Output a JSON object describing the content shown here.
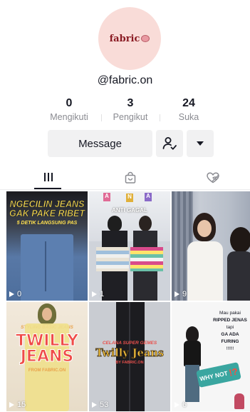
{
  "profile": {
    "avatar_text": "fabric",
    "username": "@fabric.on"
  },
  "stats": [
    {
      "value": "0",
      "label": "Mengikuti"
    },
    {
      "value": "3",
      "label": "Pengikut"
    },
    {
      "value": "24",
      "label": "Suka"
    }
  ],
  "actions": {
    "message_label": "Message",
    "follow_icon": "person-check-icon",
    "more_icon": "caret-down-icon"
  },
  "tabs": [
    {
      "name": "videos",
      "icon": "grid-icon",
      "active": true
    },
    {
      "name": "shop",
      "icon": "shopping-bag-icon",
      "active": false
    },
    {
      "name": "liked",
      "icon": "hidden-heart-icon",
      "active": false
    }
  ],
  "videos": [
    {
      "views": "0",
      "title_1": "NGECILIN JEANS",
      "title_2": "GAK PAKE RIBET",
      "subtitle": "5 DETIK LANGSUNG PAS"
    },
    {
      "views": "1",
      "title_1": "ANTI GAGAL",
      "letters": [
        "A",
        "N",
        "A"
      ]
    },
    {
      "views": "9"
    },
    {
      "views": "15",
      "title_1": "STYLING BASIC JEANS",
      "title_2": "TWILLY",
      "title_3": "JEANS",
      "subtitle": "FROM FABRIC.ON"
    },
    {
      "views": "53",
      "title_1": "CELANA SUPER GEMES",
      "title_2": "Twilly Jeans",
      "subtitle": "BY FABRIC.ON"
    },
    {
      "views": "6",
      "note": [
        "Mau pakai",
        "RIPPED JENAS",
        "tapi",
        "GA ADA",
        "FURING",
        "!!!!!!"
      ],
      "badge": "WHY NOT",
      "badge_mark": "!?"
    }
  ],
  "colors": {
    "accent_dark": "#161823",
    "muted": "#8a8b91",
    "button_bg": "#f1f1f2",
    "avatar_bg": "#f9dcd8"
  }
}
